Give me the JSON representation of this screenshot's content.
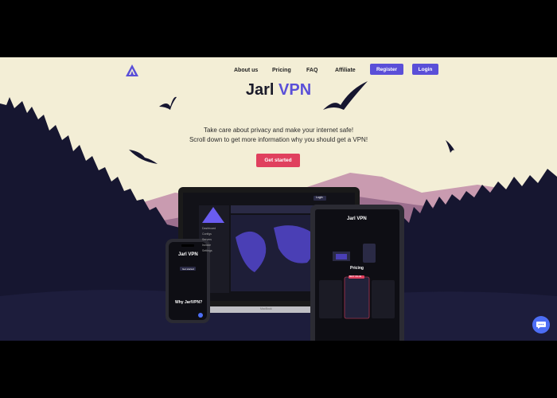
{
  "nav": {
    "logo_icon": "triangle-mountain-logo-icon",
    "links": [
      "About us",
      "Pricing",
      "FAQ",
      "Affiliate"
    ],
    "register_label": "Register",
    "login_label": "Login"
  },
  "hero": {
    "title_main": "Jarl",
    "title_accent": "VPN",
    "subtitle_line1": "Take care about privacy and make your internet safe!",
    "subtitle_line2": "Scroll down to get more information why you should get a VPN!",
    "cta_label": "Get started"
  },
  "devices": {
    "laptop_brand": "MacBook",
    "laptop_login": "Login",
    "laptop_sidebar": [
      "Dashboard",
      "Configs",
      "Servers",
      "Invoice",
      "Settings"
    ],
    "tablet_title": "Jarl VPN",
    "tablet_pricing": "Pricing",
    "tablet_badge": "BEST VALUE",
    "phone_title": "Jarl VPN",
    "phone_button": "Get started",
    "phone_section": "Why JarlVPN?"
  },
  "chat": {
    "icon": "chat-bubble-icon"
  },
  "colors": {
    "accent": "#5a4fd8",
    "cta": "#e0405e",
    "sky": "#f3eed6",
    "mountain": "#a87895",
    "forest": "#161630",
    "chat": "#4d6ef5"
  }
}
